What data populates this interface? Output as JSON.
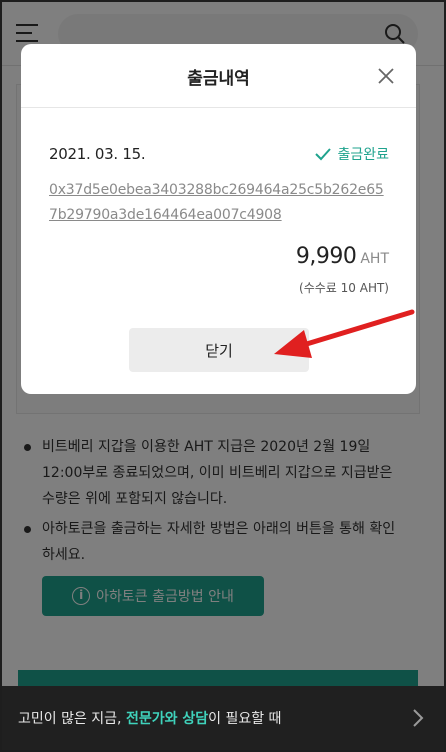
{
  "header": {
    "menu_icon": "hamburger-menu-icon",
    "search_icon": "search-icon"
  },
  "notes": [
    "비트베리 지갑을 이용한 AHT 지급은 2020년 2월 19일 12:00부로 종료되었으며, 이미 비트베리 지갑으로 지급받은 수량은 위에 포함되지 않습니다.",
    "아하토큰을 출금하는 자세한 방법은 아래의 버튼을 통해 확인하세요."
  ],
  "guide_button": {
    "label": "아하토큰 출금방법 안내",
    "icon": "info-circle-icon"
  },
  "banner": {
    "text": ""
  },
  "consult_bar": {
    "prefix": "고민이 많은 지금, ",
    "highlight_1": "전문가",
    "middle": "와 ",
    "highlight_2": "상담",
    "suffix": "이 필요할 때",
    "icon": "chevron-right-icon"
  },
  "modal": {
    "title": "출금내역",
    "close_icon": "close-icon",
    "record": {
      "date": "2021. 03. 15.",
      "status": "출금완료",
      "status_icon": "check-icon",
      "tx_hash": "0x37d5e0ebea3403288bc269464a25c5b262e657b29790a3de164464ea007c4908",
      "amount": "9,990",
      "amount_unit": "AHT",
      "fee": "(수수료 10 AHT)"
    },
    "close_button_label": "닫기"
  },
  "colors": {
    "accent": "#1fa38e",
    "overlay": "rgba(0,0,0,0.5)",
    "annotation": "#e02020"
  }
}
